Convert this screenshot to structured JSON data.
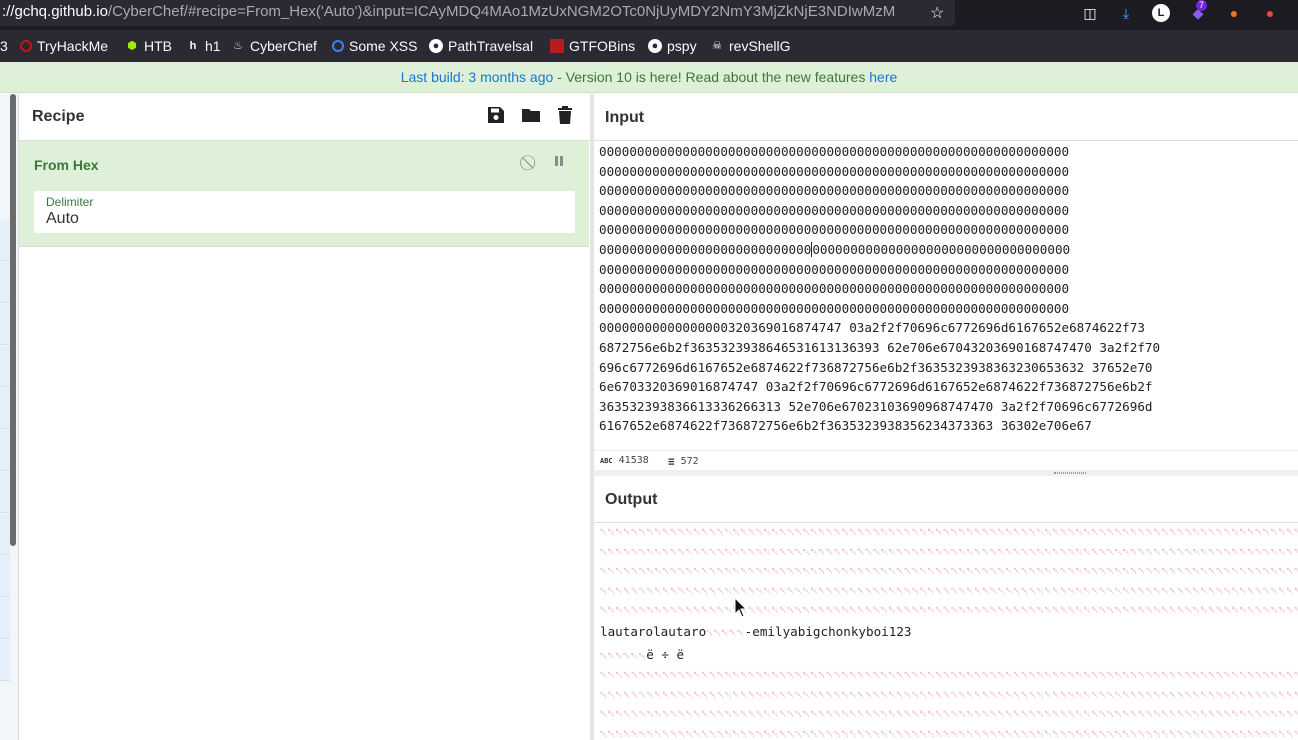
{
  "browser": {
    "url_host": "://gchq.github.io",
    "url_rest": "/CyberChef/#recipe=From_Hex('Auto')&input=ICAyMDQ4MAo1MzUxNGM2OTc0NjUyMDY2NmY3MjZkNjE3NDIwMzM",
    "extension_badge": "7"
  },
  "bookmarks": [
    {
      "label": "3"
    },
    {
      "label": "TryHackMe"
    },
    {
      "label": "HTB"
    },
    {
      "label": "h1"
    },
    {
      "label": "CyberChef"
    },
    {
      "label": "Some XSS"
    },
    {
      "label": "PathTravelsal"
    },
    {
      "label": "GTFOBins"
    },
    {
      "label": "pspy"
    },
    {
      "label": "revShellG"
    }
  ],
  "banner": {
    "text_link": "Last build: 3 months ago",
    "text_middle": " - Version 10 is here! Read about the new features ",
    "text_here": "here"
  },
  "recipe": {
    "title": "Recipe",
    "operation": {
      "name": "From Hex",
      "arg_label": "Delimiter",
      "arg_value": "Auto"
    }
  },
  "input": {
    "title": "Input",
    "line_zeros": "00000000000000000000000000000000000000000000000000000000000000",
    "line6_a": "0000000000000000000000000000",
    "line6_b": "0000000000000000000000000000000000",
    "line10": "000000000000000000320369016874747 03a2f2f70696c6772696d6167652e6874622f73",
    "hex_lines": [
      "00000000000000000320369016874747 03a2f2f70696c6772696d6167652e6874622f73",
      "6872756e6b2f3635323938646531613136393 62e706e67043203690168747470 3a2f2f70",
      "696c6772696d6167652e6874622f736872756e6b2f3635323938363230653632 37652e70",
      "6e6703320369016874747 03a2f2f70696c6772696d6167652e6874622f736872756e6b2f",
      "363532393836613336266313 52e706e67023103690968747470 3a2f2f70696c6772696d",
      "6167652e6874622f736872756e6b2f3635323938356234373363 36302e706e67"
    ],
    "stats": {
      "length": "41538",
      "lines": "572"
    }
  },
  "output": {
    "title": "Output",
    "decoded_text": "lautarolautaro",
    "decoded_text2": "-emilyabigchonkyboi123",
    "small_line": "ë ÷ ë"
  }
}
